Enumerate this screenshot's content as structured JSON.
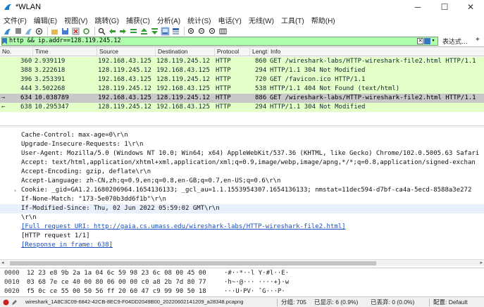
{
  "window": {
    "title": "*WLAN",
    "minimize": "─",
    "maximize": "☐",
    "close": "✕"
  },
  "menu": [
    "文件(F)",
    "编辑(E)",
    "视图(V)",
    "跳转(G)",
    "捕获(C)",
    "分析(A)",
    "统计(S)",
    "电话(Y)",
    "无线(W)",
    "工具(T)",
    "帮助(H)"
  ],
  "filter": {
    "value": "http && ip.addr==128.119.245.12",
    "expression_label": "表达式…",
    "plus": "+"
  },
  "packet_list": {
    "columns": [
      "No.",
      "Time",
      "Source",
      "Destination",
      "Protocol",
      "Lengt",
      "Info"
    ],
    "rows": [
      {
        "no": "360",
        "time": "2.939119",
        "src": "192.168.43.125",
        "dst": "128.119.245.12",
        "proto": "HTTP",
        "len": "860",
        "info": "GET /wireshark-labs/HTTP-wireshark-file2.html HTTP/1.1",
        "arrow": ""
      },
      {
        "no": "388",
        "time": "3.222618",
        "src": "128.119.245.12",
        "dst": "192.168.43.125",
        "proto": "HTTP",
        "len": "294",
        "info": "HTTP/1.1 304 Not Modified",
        "arrow": ""
      },
      {
        "no": "396",
        "time": "3.253391",
        "src": "192.168.43.125",
        "dst": "128.119.245.12",
        "proto": "HTTP",
        "len": "720",
        "info": "GET /favicon.ico HTTP/1.1",
        "arrow": ""
      },
      {
        "no": "444",
        "time": "3.502268",
        "src": "128.119.245.12",
        "dst": "192.168.43.125",
        "proto": "HTTP",
        "len": "538",
        "info": "HTTP/1.1 404 Not Found  (text/html)",
        "arrow": ""
      },
      {
        "no": "634",
        "time": "10.038789",
        "src": "192.168.43.125",
        "dst": "128.119.245.12",
        "proto": "HTTP",
        "len": "886",
        "info": "GET /wireshark-labs/HTTP-wireshark-file2.html HTTP/1.1",
        "arrow": "→"
      },
      {
        "no": "638",
        "time": "10.295347",
        "src": "128.119.245.12",
        "dst": "192.168.43.125",
        "proto": "HTTP",
        "len": "294",
        "info": "HTTP/1.1 304 Not Modified",
        "arrow": "←"
      }
    ]
  },
  "details": {
    "lines": [
      "Cache-Control: max-age=0\\r\\n",
      "Upgrade-Insecure-Requests: 1\\r\\n",
      "User-Agent: Mozilla/5.0 (Windows NT 10.0; Win64; x64) AppleWebKit/537.36 (KHTML, like Gecko) Chrome/102.0.5005.63 Safari",
      "Accept: text/html,application/xhtml+xml,application/xml;q=0.9,image/webp,image/apng,*/*;q=0.8,application/signed-exchan",
      "Accept-Encoding: gzip, deflate\\r\\n",
      "Accept-Language: zh-CN,zh;q=0.9,en;q=0.8,en-GB;q=0.7,en-US;q=0.6\\r\\n",
      "Cookie: _gid=GA1.2.1680206964.1654136133; _gcl_au=1.1.1553954307.1654136133; nmstat=11dec594-d7bf-ca4a-5ecd-8588a3e272",
      "If-None-Match: \"173-5e070b3dd6f1b\"\\r\\n",
      "If-Modified-Since: Thu, 02 Jun 2022 05:59:02 GMT\\r\\n",
      "\\r\\n",
      "[Full request URI: http://gaia.cs.umass.edu/wireshark-labs/HTTP-wireshark-file2.html]",
      "[HTTP request 1/1]",
      "[Response in frame: 638]"
    ],
    "cookie_expander": "›"
  },
  "hex": {
    "rows": [
      {
        "offset": "0000",
        "bytes": "12 23 e8 9b 2a 1a 04 6c  59 98 23 6c 08 00 45 00",
        "ascii": "·#··*··l Y·#l··E·"
      },
      {
        "offset": "0010",
        "bytes": "03 68 7e ce 40 00 80 06  00 00 c0 a8 2b 7d 80 77",
        "ascii": "·h~·@··· ····+}·w"
      },
      {
        "offset": "0020",
        "bytes": "f5 0c ce 55 00 50 56 ff  20 60 47 c9 99 90 50 18",
        "ascii": "···U·PV· ˆG···P·"
      }
    ]
  },
  "status": {
    "file": "wireshark_1A8C3C09-6842-42CB-8EC9-F04DD2049B00_20220602141209_a28348.pcapng",
    "packets": "分组: 705",
    "displayed": "已显示: 6 (0.9%)",
    "dropped": "已丢弃: 0 (0.0%)",
    "profile": "配置: Default"
  },
  "colors": {
    "http_row": "#e4ffc7",
    "selected_row": "#c8c8c8",
    "filter_valid": "#afffaf",
    "link": "#1a4fbf"
  }
}
